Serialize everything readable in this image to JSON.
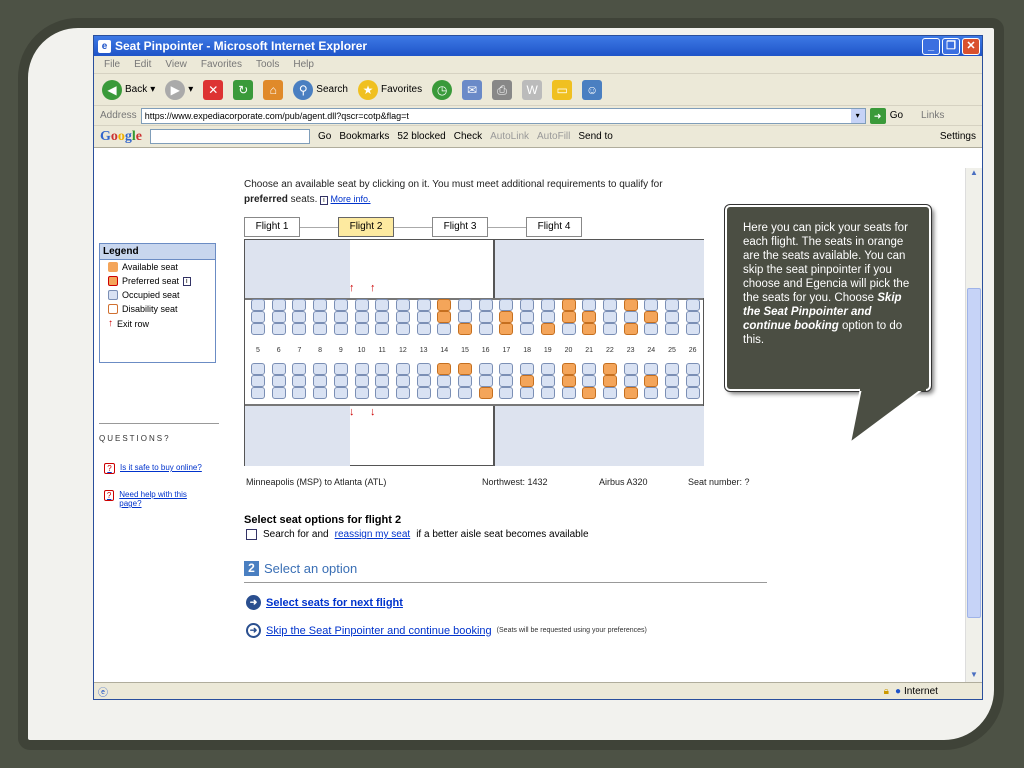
{
  "window": {
    "title": "Seat Pinpointer - Microsoft Internet Explorer"
  },
  "menu": [
    "File",
    "Edit",
    "View",
    "Favorites",
    "Tools",
    "Help"
  ],
  "toolbar": {
    "back": "Back",
    "search": "Search",
    "favorites": "Favorites"
  },
  "address": {
    "label": "Address",
    "url": "https://www.expediacorporate.com/pub/agent.dll?qscr=cotp&flag=t",
    "go": "Go",
    "links": "Links"
  },
  "google": {
    "logo": "Google",
    "go": "Go",
    "bookmarks": "Bookmarks",
    "blocked": "52 blocked",
    "check": "Check",
    "autolink": "AutoLink",
    "autofill": "AutoFill",
    "sendto": "Send to",
    "settings": "Settings"
  },
  "legend": {
    "title": "Legend",
    "items": [
      {
        "label": "Available seat",
        "icon": "available-seat-icon"
      },
      {
        "label": "Preferred seat",
        "icon": "preferred-seat-icon"
      },
      {
        "label": "Occupied seat",
        "icon": "occupied-seat-icon"
      },
      {
        "label": "Disability seat",
        "icon": "disability-seat-icon"
      },
      {
        "label": "Exit row",
        "icon": "exit-row-arrow-icon"
      }
    ]
  },
  "questions": {
    "title": "QUESTIONS?",
    "links": [
      "Is it safe to buy online?",
      "Need help with this page?"
    ]
  },
  "intro": {
    "text": "Choose an available seat by clicking on it. You must meet additional requirements to qualify for",
    "bold": "preferred",
    "after": " seats.",
    "more": "More info."
  },
  "flights": [
    "Flight 1",
    "Flight 2",
    "Flight 3",
    "Flight 4"
  ],
  "active_flight": 1,
  "row_numbers": [
    "5",
    "6",
    "7",
    "8",
    "9",
    "10",
    "11",
    "12",
    "13",
    "14",
    "15",
    "16",
    "17",
    "18",
    "19",
    "20",
    "21",
    "22",
    "23",
    "24",
    "25",
    "26"
  ],
  "flight_info": {
    "route": "Minneapolis (MSP) to Atlanta (ATL)",
    "flight": "Northwest: 1432",
    "aircraft": "Airbus A320",
    "seat": "Seat number: ?"
  },
  "options": {
    "title": "Select seat options for flight 2",
    "text1": "Search for and ",
    "link": "reassign my seat",
    "text2": " if a better aisle seat becomes available"
  },
  "section2": {
    "num": "2",
    "title": "Select an option"
  },
  "actions": {
    "next": "Select seats for next flight",
    "skip": "Skip the Seat Pinpointer and continue booking",
    "skip_note": "(Seats will be requested using your preferences)"
  },
  "status": {
    "zone": "Internet"
  },
  "callout": {
    "text1": "Here you can pick your seats for each flight.  The seats in orange are the seats available.  You can skip the seat pinpointer if you choose and Egencia will pick the the seats for you.  Choose ",
    "bold": "Skip the Seat Pinpointer and continue booking",
    "text2": " option to do this."
  },
  "colors": {
    "available": "#f4a55a",
    "occupied": "#d9e2f3",
    "accent": "#3a6fb5"
  }
}
